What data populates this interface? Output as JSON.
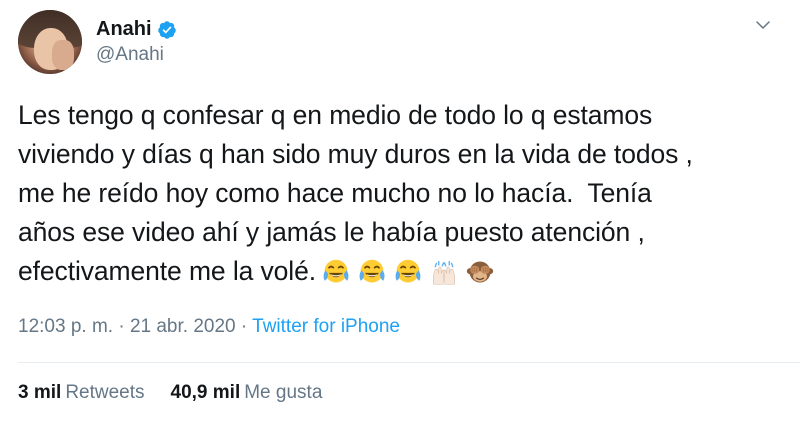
{
  "user": {
    "display_name": "Anahi",
    "handle": "@Anahi",
    "verified": true,
    "avatar": "profile-photo"
  },
  "tweet": {
    "lines": [
      "Les tengo q confesar q en medio de todo lo q estamos",
      "viviendo y días q han sido muy duros en la vida de todos ,",
      "me he reído hoy como hace mucho no lo hacía.  Tenía",
      "años ese video ahí y jamás le había puesto atención ,",
      "efectivamente me la volé."
    ],
    "emojis": [
      "face-with-tears-of-joy",
      "face-with-tears-of-joy",
      "face-with-tears-of-joy",
      "raising-hands",
      "see-no-evil-monkey"
    ]
  },
  "meta": {
    "time": "12:03 p. m.",
    "separator": "·",
    "date": "21 abr. 2020",
    "source": "Twitter for iPhone"
  },
  "stats": {
    "retweets_count": "3 mil",
    "retweets_label": "Retweets",
    "likes_count": "40,9 mil",
    "likes_label": "Me gusta"
  },
  "colors": {
    "link": "#1da1f2",
    "secondary": "#657786",
    "text": "#14171a",
    "divider": "#e6ecf0"
  }
}
